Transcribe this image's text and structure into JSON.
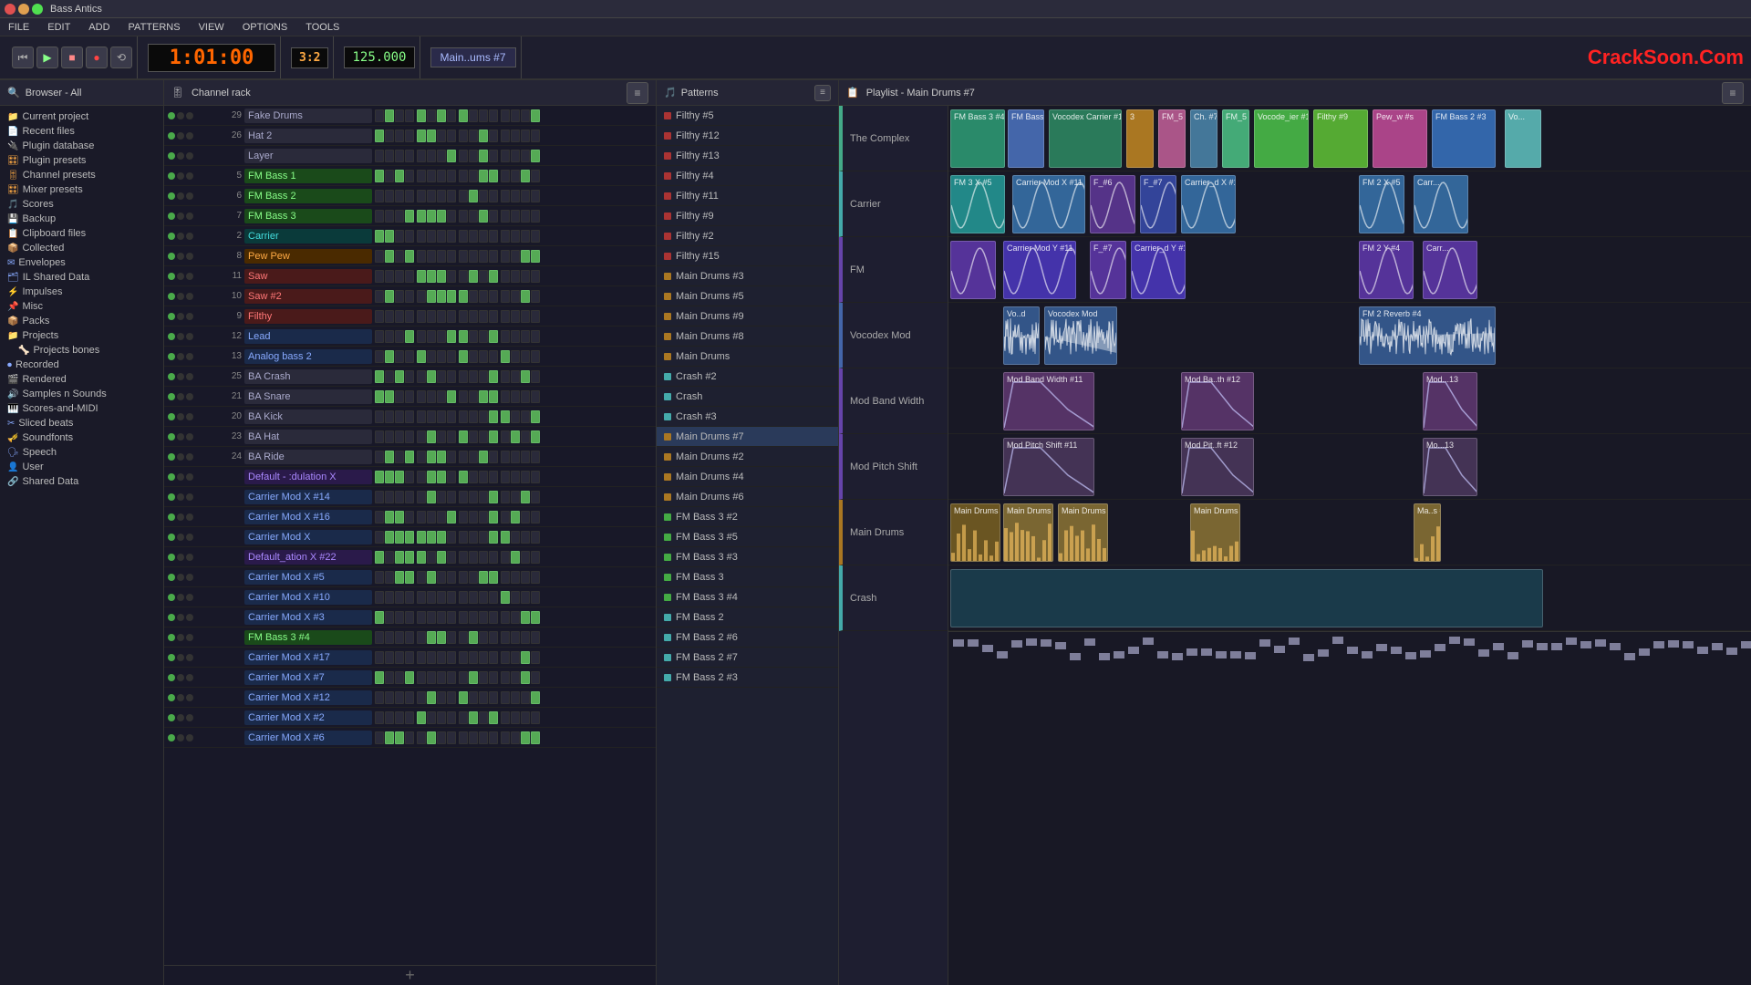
{
  "app": {
    "title": "Bass Antics",
    "window_title": "Bass Antics"
  },
  "menu": {
    "items": [
      "FILE",
      "EDIT",
      "ADD",
      "PATTERNS",
      "VIEW",
      "OPTIONS",
      "TOOLS"
    ]
  },
  "transport": {
    "time": "1:01:00",
    "bpm": "125.000",
    "pattern_num": "3:2",
    "pattern_label": "Main..ums #7",
    "play_label": "▶",
    "stop_label": "■",
    "record_label": "●",
    "rewind_label": "⏮"
  },
  "sidebar": {
    "header": "Browser - All",
    "items": [
      {
        "label": "Current project",
        "icon": "📁",
        "indent": 0,
        "type": "folder"
      },
      {
        "label": "Recent files",
        "icon": "📄",
        "indent": 0,
        "type": "folder"
      },
      {
        "label": "Plugin database",
        "icon": "🔌",
        "indent": 0,
        "type": "folder"
      },
      {
        "label": "Plugin presets",
        "icon": "🎛",
        "indent": 0,
        "type": "folder"
      },
      {
        "label": "Channel presets",
        "icon": "🎚",
        "indent": 0,
        "type": "folder"
      },
      {
        "label": "Mixer presets",
        "icon": "🎛",
        "indent": 0,
        "type": "folder"
      },
      {
        "label": "Scores",
        "icon": "🎵",
        "indent": 0,
        "type": "item"
      },
      {
        "label": "Backup",
        "icon": "💾",
        "indent": 0,
        "type": "folder"
      },
      {
        "label": "Clipboard files",
        "icon": "📋",
        "indent": 0,
        "type": "item"
      },
      {
        "label": "Collected",
        "icon": "📦",
        "indent": 0,
        "type": "item"
      },
      {
        "label": "Envelopes",
        "icon": "✉",
        "indent": 0,
        "type": "item"
      },
      {
        "label": "IL Shared Data",
        "icon": "🗂",
        "indent": 0,
        "type": "item"
      },
      {
        "label": "Impulses",
        "icon": "⚡",
        "indent": 0,
        "type": "item"
      },
      {
        "label": "Misc",
        "icon": "📌",
        "indent": 0,
        "type": "item"
      },
      {
        "label": "Packs",
        "icon": "📦",
        "indent": 0,
        "type": "folder"
      },
      {
        "label": "Projects",
        "icon": "📁",
        "indent": 0,
        "type": "folder"
      },
      {
        "label": "Projects bones",
        "icon": "🦴",
        "indent": 1,
        "type": "item"
      },
      {
        "label": "Recorded",
        "icon": "⏺",
        "indent": 0,
        "type": "item"
      },
      {
        "label": "Rendered",
        "icon": "🎬",
        "indent": 0,
        "type": "item"
      },
      {
        "label": "Samples n Sounds",
        "icon": "🔊",
        "indent": 0,
        "type": "folder"
      },
      {
        "label": "Scores-and-MIDI",
        "icon": "🎹",
        "indent": 0,
        "type": "folder"
      },
      {
        "label": "Sliced beats",
        "icon": "✂",
        "indent": 0,
        "type": "item"
      },
      {
        "label": "Soundfonts",
        "icon": "🎺",
        "indent": 0,
        "type": "folder"
      },
      {
        "label": "Speech",
        "icon": "🗣",
        "indent": 0,
        "type": "item"
      },
      {
        "label": "User",
        "icon": "👤",
        "indent": 0,
        "type": "folder"
      },
      {
        "label": "Shared Data",
        "icon": "🔗",
        "indent": 0,
        "type": "item"
      }
    ]
  },
  "channel_rack": {
    "header": "Channel rack",
    "channels": [
      {
        "num": "29",
        "name": "Fake Drums",
        "color": "gray",
        "active": true
      },
      {
        "num": "26",
        "name": "Hat 2",
        "color": "gray",
        "active": true
      },
      {
        "num": "",
        "name": "Layer",
        "color": "gray",
        "active": true
      },
      {
        "num": "5",
        "name": "FM Bass 1",
        "color": "green",
        "active": true
      },
      {
        "num": "6",
        "name": "FM Bass 2",
        "color": "green",
        "active": true
      },
      {
        "num": "7",
        "name": "FM Bass 3",
        "color": "green",
        "active": true
      },
      {
        "num": "2",
        "name": "Carrier",
        "color": "teal",
        "active": true
      },
      {
        "num": "8",
        "name": "Pew Pew",
        "color": "orange",
        "active": true
      },
      {
        "num": "11",
        "name": "Saw",
        "color": "red",
        "active": true
      },
      {
        "num": "10",
        "name": "Saw #2",
        "color": "red",
        "active": true
      },
      {
        "num": "9",
        "name": "Filthy",
        "color": "red",
        "active": true
      },
      {
        "num": "12",
        "name": "Lead",
        "color": "blue",
        "active": true
      },
      {
        "num": "13",
        "name": "Analog bass 2",
        "color": "blue",
        "active": true
      },
      {
        "num": "25",
        "name": "BA Crash",
        "color": "gray",
        "active": true
      },
      {
        "num": "21",
        "name": "BA Snare",
        "color": "gray",
        "active": true
      },
      {
        "num": "20",
        "name": "BA Kick",
        "color": "gray",
        "active": true
      },
      {
        "num": "23",
        "name": "BA Hat",
        "color": "gray",
        "active": true
      },
      {
        "num": "24",
        "name": "BA Ride",
        "color": "gray",
        "active": true
      },
      {
        "num": "",
        "name": "Default - :dulation X",
        "color": "purple",
        "active": true
      },
      {
        "num": "",
        "name": "Carrier Mod X #14",
        "color": "blue",
        "active": true
      },
      {
        "num": "",
        "name": "Carrier Mod X #16",
        "color": "blue",
        "active": true
      },
      {
        "num": "",
        "name": "Carrier Mod X",
        "color": "blue",
        "active": true
      },
      {
        "num": "",
        "name": "Default_ation X #22",
        "color": "purple",
        "active": true
      },
      {
        "num": "",
        "name": "Carrier Mod X #5",
        "color": "blue",
        "active": true
      },
      {
        "num": "",
        "name": "Carrier Mod X #10",
        "color": "blue",
        "active": true
      },
      {
        "num": "",
        "name": "Carrier Mod X #3",
        "color": "blue",
        "active": true
      },
      {
        "num": "",
        "name": "FM Bass 3 #4",
        "color": "green",
        "active": true
      },
      {
        "num": "",
        "name": "Carrier Mod X #17",
        "color": "blue",
        "active": true
      },
      {
        "num": "",
        "name": "Carrier Mod X #7",
        "color": "blue",
        "active": true
      },
      {
        "num": "",
        "name": "Carrier Mod X #12",
        "color": "blue",
        "active": true
      },
      {
        "num": "",
        "name": "Carrier Mod X #2",
        "color": "blue",
        "active": true
      },
      {
        "num": "",
        "name": "Carrier Mod X #6",
        "color": "blue",
        "active": true
      }
    ]
  },
  "patterns": {
    "header": "Patterns",
    "items": [
      {
        "label": "Filthy #5",
        "color": "red"
      },
      {
        "label": "Filthy #12",
        "color": "red"
      },
      {
        "label": "Filthy #13",
        "color": "red"
      },
      {
        "label": "Filthy #4",
        "color": "red"
      },
      {
        "label": "Filthy #11",
        "color": "red"
      },
      {
        "label": "Filthy #9",
        "color": "red"
      },
      {
        "label": "Filthy #2",
        "color": "red"
      },
      {
        "label": "Filthy #15",
        "color": "red"
      },
      {
        "label": "Main Drums #3",
        "color": "orange"
      },
      {
        "label": "Main Drums #5",
        "color": "orange"
      },
      {
        "label": "Main Drums #9",
        "color": "orange"
      },
      {
        "label": "Main Drums #8",
        "color": "orange"
      },
      {
        "label": "Main Drums",
        "color": "orange"
      },
      {
        "label": "Crash #2",
        "color": "teal"
      },
      {
        "label": "Crash",
        "color": "teal"
      },
      {
        "label": "Crash #3",
        "color": "teal"
      },
      {
        "label": "Main Drums #7",
        "color": "orange",
        "selected": true
      },
      {
        "label": "Main Drums #2",
        "color": "orange"
      },
      {
        "label": "Main Drums #4",
        "color": "orange"
      },
      {
        "label": "Main Drums #6",
        "color": "orange"
      },
      {
        "label": "FM Bass 3 #2",
        "color": "green"
      },
      {
        "label": "FM Bass 3 #5",
        "color": "green"
      },
      {
        "label": "FM Bass 3 #3",
        "color": "green"
      },
      {
        "label": "FM Bass 3",
        "color": "green"
      },
      {
        "label": "FM Bass 3 #4",
        "color": "green"
      },
      {
        "label": "FM Bass 2",
        "color": "teal"
      },
      {
        "label": "FM Bass 2 #6",
        "color": "teal"
      },
      {
        "label": "FM Bass 2 #7",
        "color": "teal"
      },
      {
        "label": "FM Bass 2 #3",
        "color": "teal"
      }
    ]
  },
  "playlist": {
    "header": "Playlist - Main Drums #7",
    "tracks": [
      {
        "label": "The Complex",
        "color": "#44aa88"
      },
      {
        "label": "Carrier",
        "color": "#44aaaa"
      },
      {
        "label": "FM",
        "color": "#6644aa"
      },
      {
        "label": "Vocodex Mod",
        "color": "#4466aa"
      },
      {
        "label": "Mod Band Width",
        "color": "#6644aa"
      },
      {
        "label": "Mod Pitch Shift",
        "color": "#6644aa"
      },
      {
        "label": "Main Drums",
        "color": "#aa7722"
      },
      {
        "label": "Crash",
        "color": "#44aaaa"
      }
    ]
  },
  "watermark": "CrackSoon.Com"
}
